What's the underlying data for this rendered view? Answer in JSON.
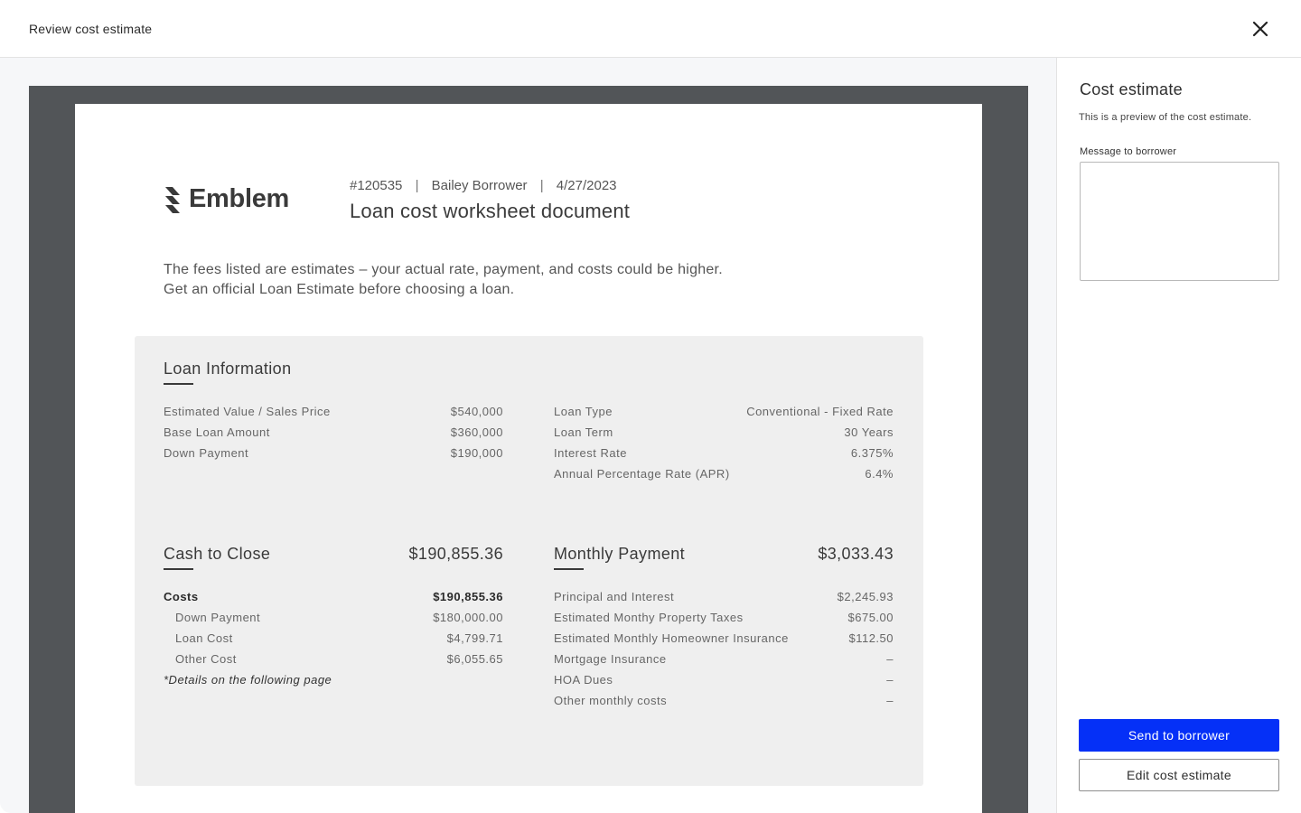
{
  "header": {
    "title": "Review cost estimate",
    "close_icon": "close-icon"
  },
  "document": {
    "logo": {
      "icon": "emblem-logo-icon",
      "text": "Emblem"
    },
    "meta": {
      "number": "#120535",
      "sep1": "|",
      "borrower": "Bailey Borrower",
      "sep2": "|",
      "date": "4/27/2023"
    },
    "title": "Loan cost worksheet document",
    "disclaimer": [
      "The fees listed are estimates – your actual rate, payment, and costs could be higher.",
      "Get an official Loan Estimate before choosing a loan."
    ],
    "loan_information": {
      "title": "Loan Information",
      "left_rows": [
        {
          "label": "Estimated Value / Sales Price",
          "value": "$540,000"
        },
        {
          "label": "Base Loan Amount",
          "value": "$360,000"
        },
        {
          "label": "Down Payment",
          "value": "$190,000"
        }
      ],
      "right_rows": [
        {
          "label": "Loan Type",
          "value": "Conventional - Fixed Rate"
        },
        {
          "label": "Loan Term",
          "value": "30 Years"
        },
        {
          "label": "Interest Rate",
          "value": "6.375%"
        },
        {
          "label": "Annual Percentage Rate (APR)",
          "value": "6.4%"
        }
      ]
    },
    "cash_to_close": {
      "title": "Cash to Close",
      "amount": "$190,855.36",
      "rows": [
        {
          "label": "Costs",
          "value": "$190,855.36"
        },
        {
          "label": "Down Payment",
          "value": "$180,000.00"
        },
        {
          "label": "Loan Cost",
          "value": "$4,799.71"
        },
        {
          "label": "Other Cost",
          "value": "$6,055.65"
        }
      ],
      "note": "*Details on the following page"
    },
    "monthly_payment": {
      "title": "Monthly Payment",
      "amount": "$3,033.43",
      "rows": [
        {
          "label": "Principal and Interest",
          "value": "$2,245.93"
        },
        {
          "label": "Estimated Monthy Property Taxes",
          "value": "$675.00"
        },
        {
          "label": "Estimated Monthly Homeowner Insurance",
          "value": "$112.50"
        },
        {
          "label": "Mortgage Insurance",
          "value": "–"
        },
        {
          "label": "HOA Dues",
          "value": "–"
        },
        {
          "label": "Other monthly costs",
          "value": "–"
        }
      ]
    }
  },
  "sidebar": {
    "title": "Cost estimate",
    "subtitle": "This is a preview of the cost estimate.",
    "message_label": "Message to borrower",
    "message_value": "",
    "send_button": "Send to borrower",
    "edit_button": "Edit cost estimate"
  },
  "colors": {
    "primary_button": "#0530f7",
    "frame": "#525558",
    "card": "#efefef"
  }
}
